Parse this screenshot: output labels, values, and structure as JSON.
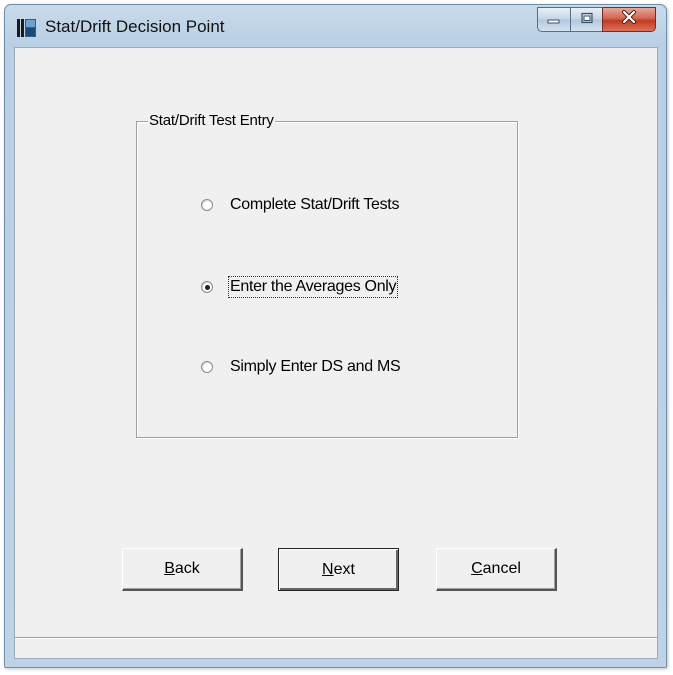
{
  "window": {
    "title": "Stat/Drift Decision Point",
    "icon": "app-icon",
    "controls": {
      "minimize": "minimize-icon",
      "maximize": "maximize-icon",
      "close": "close-icon"
    }
  },
  "group": {
    "title": "Stat/Drift Test Entry",
    "options": [
      {
        "label": "Complete Stat/Drift Tests",
        "checked": false
      },
      {
        "label": "Enter the Averages Only",
        "checked": true
      },
      {
        "label": "Simply Enter DS and MS",
        "checked": false
      }
    ]
  },
  "buttons": {
    "back": {
      "accel": "B",
      "rest": "ack"
    },
    "next": {
      "accel": "N",
      "rest": "ext"
    },
    "cancel": {
      "accel": "C",
      "rest": "ancel"
    }
  },
  "status_bar": {
    "text": ""
  }
}
